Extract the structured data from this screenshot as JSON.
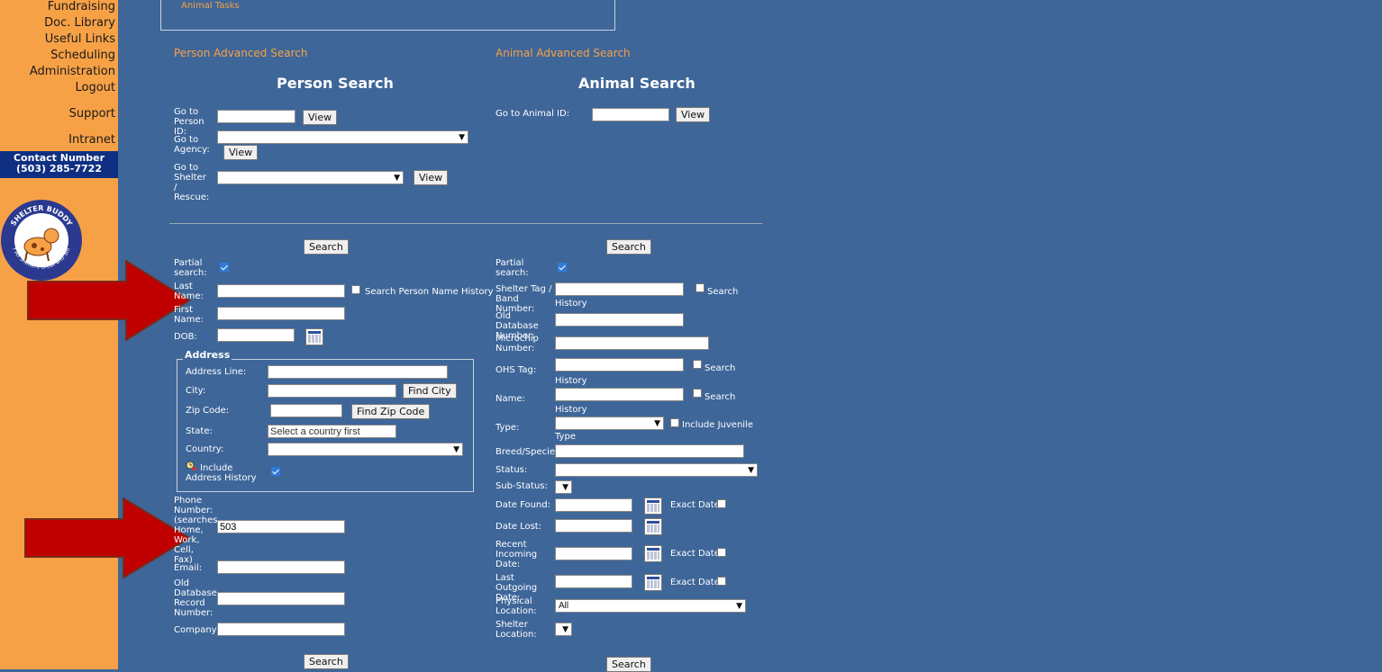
{
  "sidebar": {
    "nav": [
      "Fundraising",
      "Doc. Library",
      "Useful Links",
      "Scheduling",
      "Administration",
      "Logout",
      "Support",
      "Intranet"
    ],
    "contact_label": "Contact Number",
    "contact_phone": "(503) 285-7722",
    "logo_text": "SHELTER BUDDY",
    "logo_subtext": "For All Shelters Great and Small"
  },
  "top_box": {
    "link": "Animal Tasks"
  },
  "person": {
    "header": "Person Advanced Search",
    "title": "Person Search",
    "go_person_id": "Go to Person ID:",
    "go_agency": "Go to Agency:",
    "go_shelter": "Go to Shelter / Rescue:",
    "view": "View",
    "search": "Search",
    "partial": "Partial search:",
    "last_name": "Last Name:",
    "search_name_history": "Search Person Name History",
    "first_name": "First Name:",
    "dob": "DOB:",
    "address_legend": "Address",
    "address_line": "Address Line:",
    "city": "City:",
    "find_city": "Find City",
    "zip": "Zip Code:",
    "find_zip": "Find Zip Code",
    "state": "State:",
    "state_placeholder": "Select a country first",
    "country": "Country:",
    "include_addr_hist": "Include Address History",
    "phone": "Phone Number: (searches Home, Work, Cell, Fax)",
    "phone_value": "503",
    "email": "Email:",
    "old_db_record": "Old Database Record Number:",
    "company": "Company:"
  },
  "animal": {
    "header": "Animal Advanced Search",
    "title": "Animal Search",
    "go_animal_id": "Go to Animal ID:",
    "view": "View",
    "search": "Search",
    "partial": "Partial search:",
    "shelter_tag": "Shelter Tag / Band Number:",
    "search_history": "Search History",
    "old_db_number": "Old Database Number:",
    "microchip": "Microchip Number:",
    "ohs_tag": "OHS Tag:",
    "name": "Name:",
    "type": "Type:",
    "include_juvenile": "Include Juvenile Type",
    "breed": "Breed/Species",
    "status": "Status:",
    "sub_status": "Sub-Status:",
    "date_found": "Date Found:",
    "exact_date": "Exact Date",
    "date_lost": "Date Lost:",
    "recent_incoming": "Recent Incoming Date:",
    "last_outgoing": "Last Outgoing Date:",
    "physical_location": "Physical Location:",
    "physical_location_value": "All",
    "shelter_location": "Shelter Location:"
  }
}
